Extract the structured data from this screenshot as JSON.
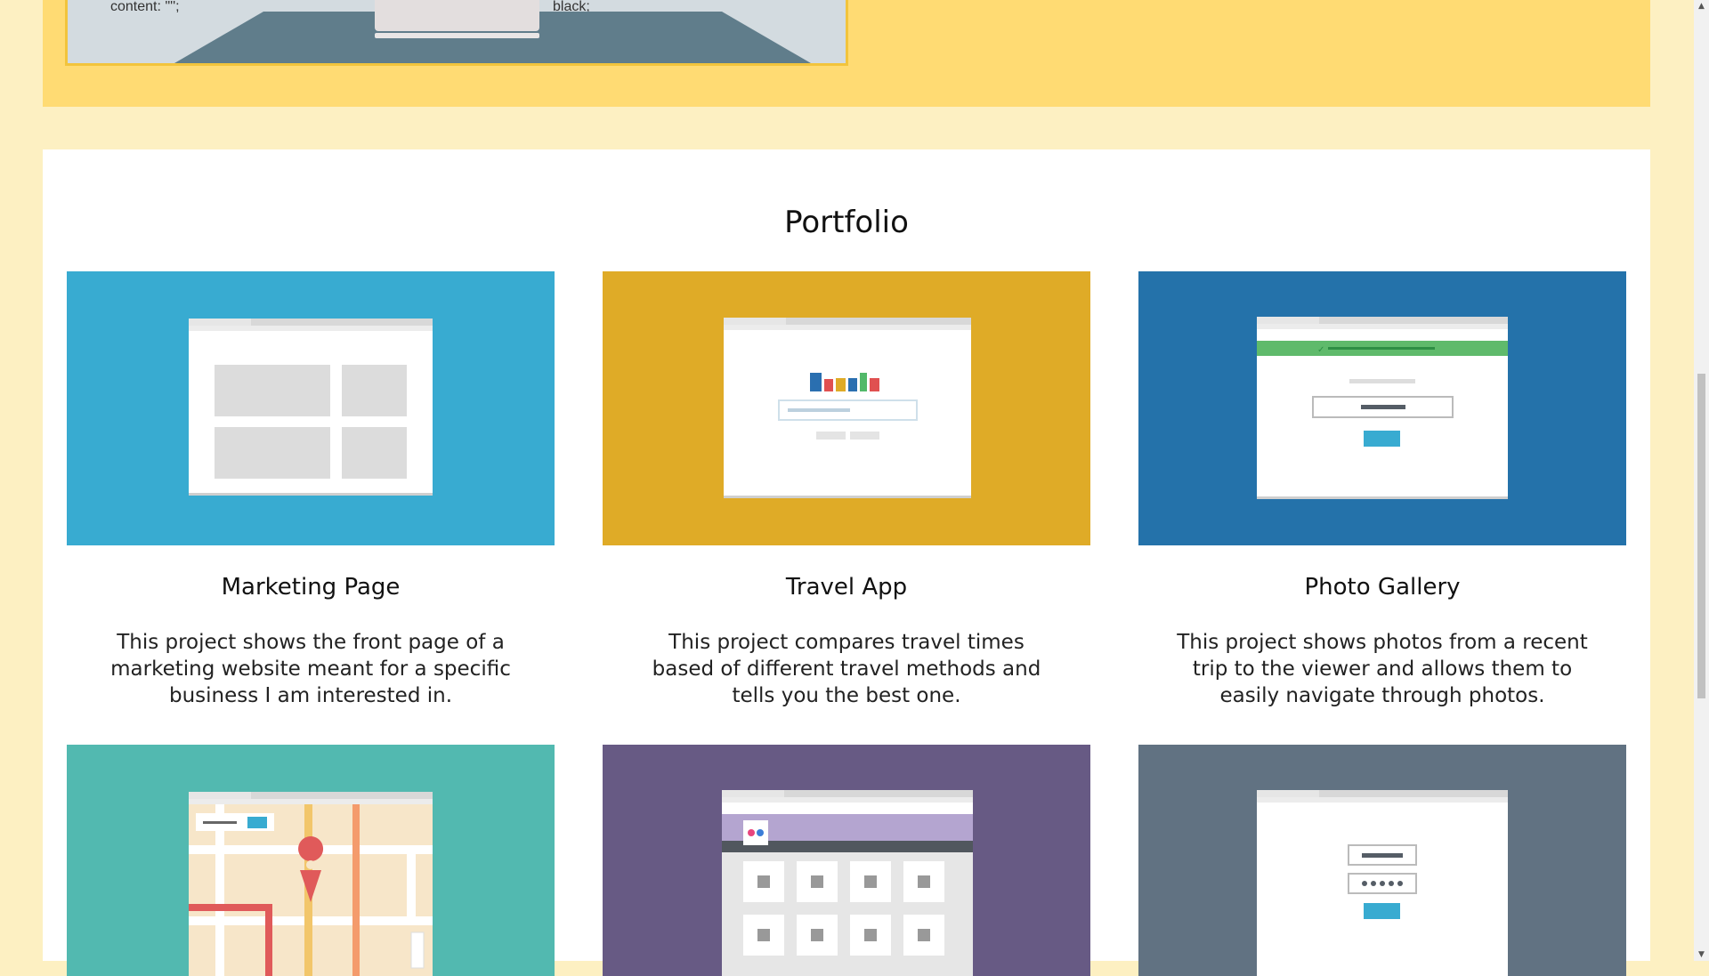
{
  "hero": {
    "code_left": "content: '\"';",
    "code_right": "black;"
  },
  "portfolio": {
    "title": "Portfolio",
    "projects": [
      {
        "title": "Marketing Page",
        "description": "This project shows the front page of a marketing website meant for a specific business I am interested in.",
        "color": "#38abd1",
        "icon": "marketing-thumbnail"
      },
      {
        "title": "Travel App",
        "description": "This project compares travel times based of different travel methods and tells you the best one.",
        "color": "#dfab27",
        "icon": "travel-app-thumbnail"
      },
      {
        "title": "Photo Gallery",
        "description": "This project shows photos from a recent trip to the viewer and allows them to easily navigate through photos.",
        "color": "#2472aa",
        "icon": "photo-gallery-thumbnail"
      },
      {
        "title": "",
        "description": "",
        "color": "#52b9b0",
        "icon": "map-thumbnail"
      },
      {
        "title": "",
        "description": "",
        "color": "#675a84",
        "icon": "photo-grid-thumbnail"
      },
      {
        "title": "",
        "description": "",
        "color": "#617282",
        "icon": "login-thumbnail"
      }
    ]
  },
  "colors": {
    "page_background": "#fdf0c2",
    "hero_background": "#ffdb73",
    "section_background": "#ffffff"
  }
}
